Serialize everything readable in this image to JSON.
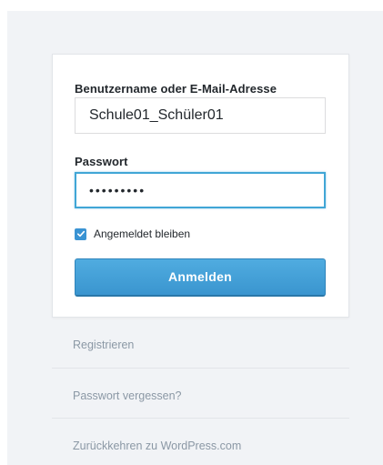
{
  "form": {
    "username_label": "Benutzername oder E-Mail-Adresse",
    "username_value": "Schule01_Schüler01",
    "password_label": "Passwort",
    "password_value": "•••••••••",
    "remember_label": "Angemeldet bleiben",
    "remember_checked": true,
    "submit_label": "Anmelden"
  },
  "links": {
    "register": "Registrieren",
    "lost_password": "Passwort vergessen?",
    "back": "Zurückkehren zu WordPress.com"
  },
  "colors": {
    "accent": "#3a93d3",
    "focus_border": "#41a6d6",
    "background": "#f1f3f6",
    "link_text": "#8b98a5"
  }
}
